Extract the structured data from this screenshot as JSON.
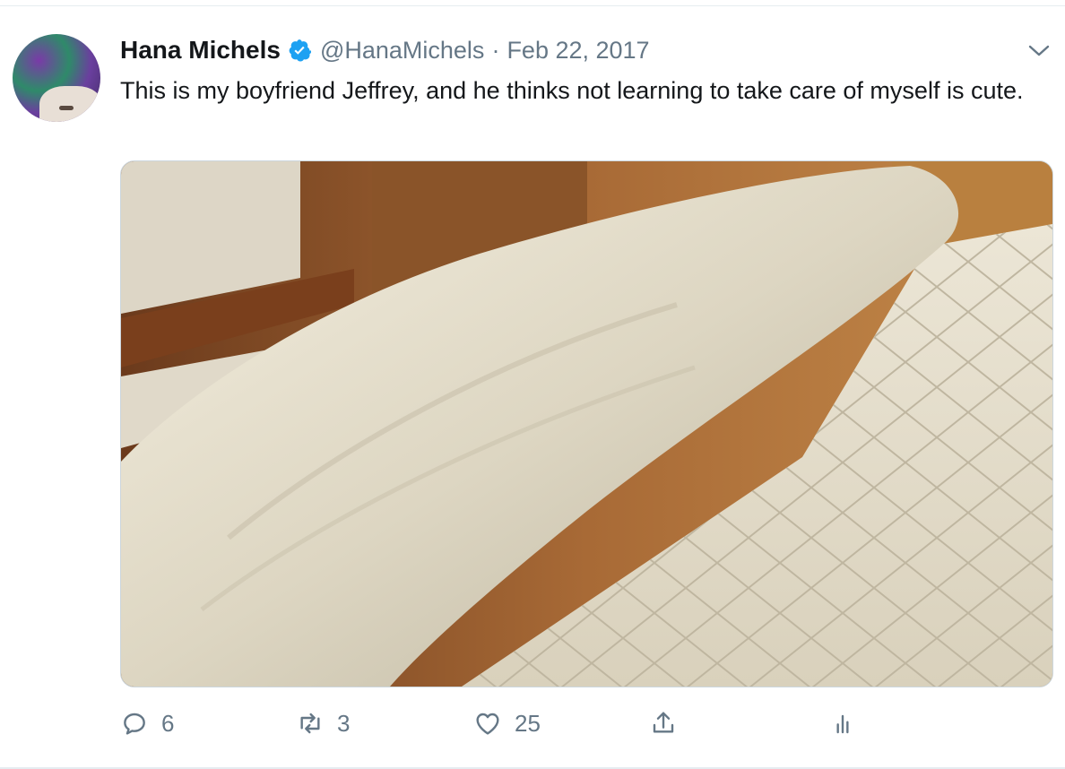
{
  "tweet": {
    "author_name": "Hana Michels",
    "handle": "@HanaMichels",
    "separator": "·",
    "date": "Feb 22, 2017",
    "text": "This is my boyfriend Jeffrey, and he thinks not learning to take care of myself is cute."
  },
  "actions": {
    "reply_count": "6",
    "retweet_count": "3",
    "like_count": "25"
  },
  "icons": {
    "verified": "verified-badge-icon",
    "menu": "chevron-down-icon",
    "reply": "reply-icon",
    "retweet": "retweet-icon",
    "like": "heart-icon",
    "share": "share-icon",
    "analytics": "analytics-icon"
  },
  "colors": {
    "verified_blue": "#1da1f2",
    "secondary_text": "#657786",
    "primary_text": "#14171a"
  }
}
